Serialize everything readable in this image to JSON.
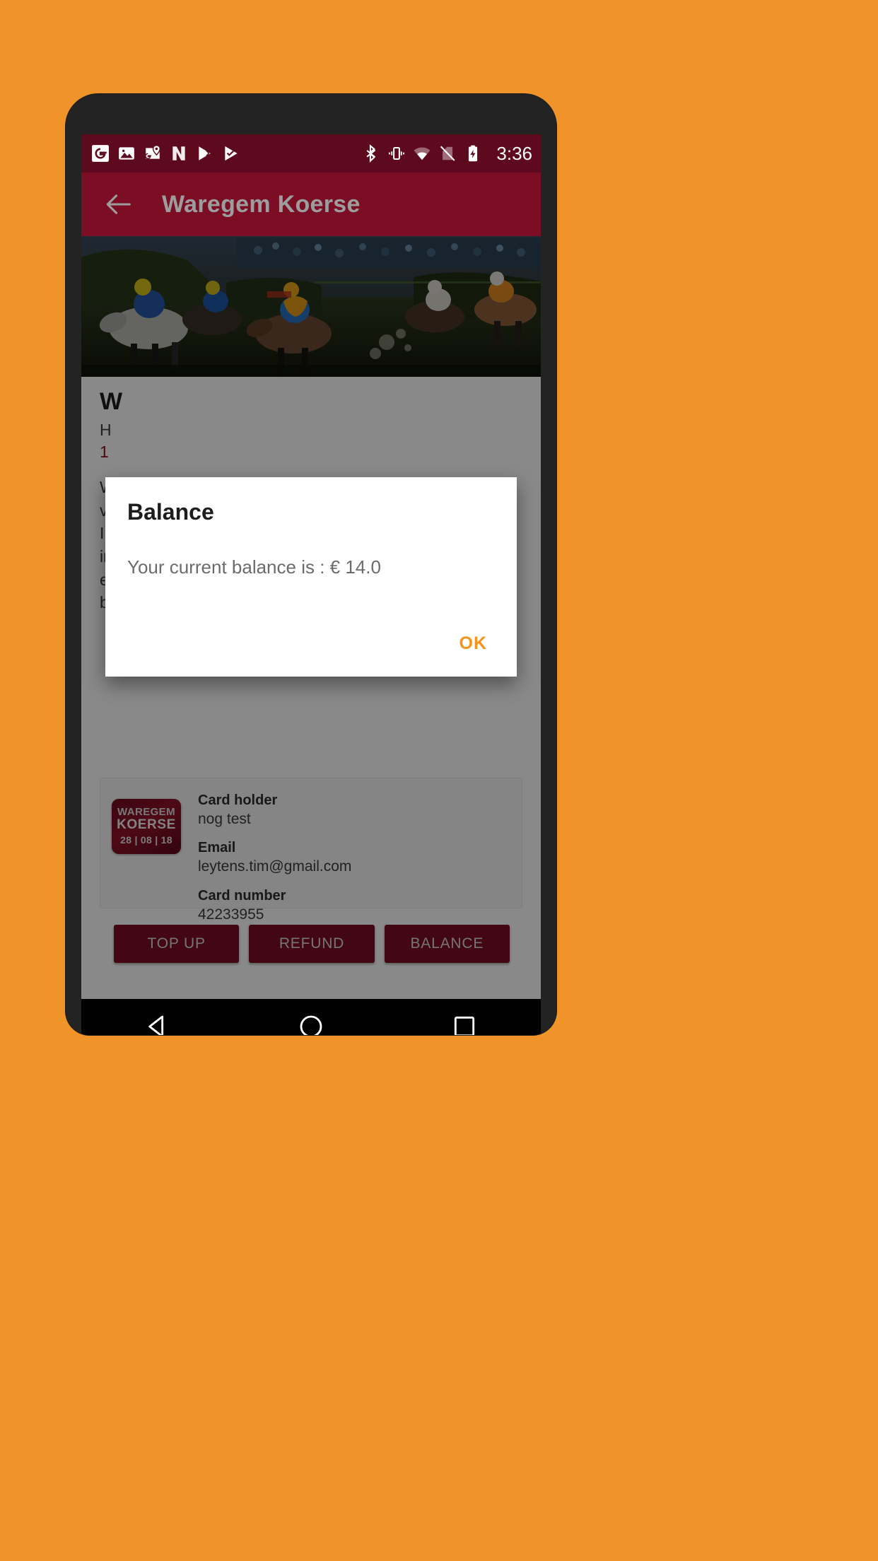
{
  "device": {
    "frame_color": "#232323",
    "wallpaper_color": "#F0942A"
  },
  "status_bar": {
    "background": "#5E0A1E",
    "time": "3:36",
    "left_icons": [
      "google-icon",
      "photos-icon",
      "google-maps-pin-icon",
      "news-icon",
      "play-store-icon",
      "play-movies-icon"
    ],
    "right_icons": [
      "bluetooth-icon",
      "vibrate-icon",
      "wifi-icon",
      "no-sim-icon",
      "battery-charging-icon"
    ]
  },
  "app_bar": {
    "background": "#7B0D25",
    "title": "Waregem Koerse",
    "back_icon": "back-arrow-icon"
  },
  "article": {
    "heading": "W",
    "sub": "H",
    "red_line": "1",
    "body_lines": [
      "W",
      "vo",
      "In",
      "in",
      "e",
      "belangstelling. Sindsdien hebben de Koninklijk"
    ],
    "red_color": "#8e0b22"
  },
  "card": {
    "logo": {
      "line1": "WAREGEM",
      "line2": "KOERSE",
      "line3": "28 | 08 | 18"
    },
    "fields": [
      {
        "label": "Card holder",
        "value": "nog test"
      },
      {
        "label": "Email",
        "value": "leytens.tim@gmail.com"
      },
      {
        "label": "Card number",
        "value": "42233955"
      }
    ]
  },
  "actions": {
    "top_up": "TOP UP",
    "refund": "REFUND",
    "balance": "BALANCE",
    "color": "#7B0D25"
  },
  "dialog": {
    "title": "Balance",
    "message": "Your current balance is : € 14.0",
    "ok_label": "OK",
    "accent": "#F59219"
  },
  "nav_bar": {
    "background": "#000000",
    "items": [
      "back-triangle-icon",
      "home-circle-icon",
      "recents-square-icon"
    ]
  }
}
